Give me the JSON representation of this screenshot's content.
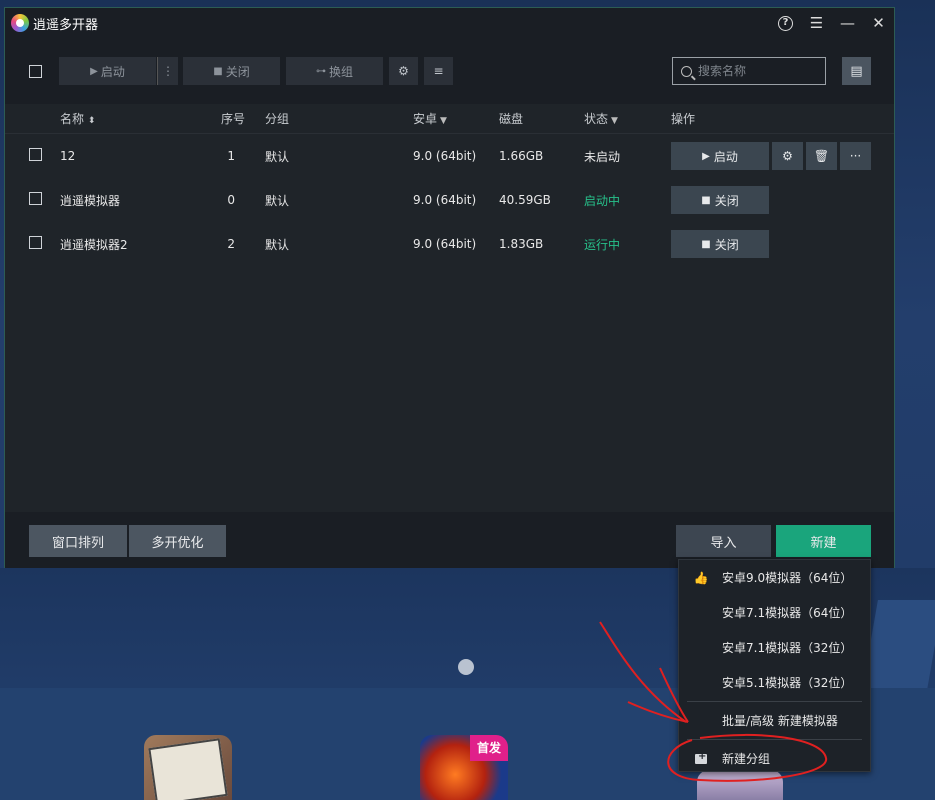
{
  "window": {
    "title": "逍遥多开器",
    "controls": {
      "help": "?",
      "menu": "☰",
      "minimize": "—",
      "close": "✕"
    }
  },
  "toolbar": {
    "start_label": "启动",
    "more_label": "⋮",
    "close_label": "关闭",
    "group_label": "换组",
    "settings_icon": "⚙",
    "list_icon": "≡",
    "search_placeholder": "搜索名称",
    "view_icon": "▤"
  },
  "table": {
    "headers": {
      "name": "名称",
      "index": "序号",
      "group": "分组",
      "android": "安卓",
      "disk": "磁盘",
      "status": "状态",
      "ops": "操作"
    },
    "rows": [
      {
        "name": "12",
        "index": "1",
        "group": "默认",
        "android": "9.0 (64bit)",
        "disk": "1.66GB",
        "status": "未启动",
        "status_state": "stopped",
        "action": "启动"
      },
      {
        "name": "逍遥模拟器",
        "index": "0",
        "group": "默认",
        "android": "9.0 (64bit)",
        "disk": "40.59GB",
        "status": "启动中",
        "status_state": "on",
        "action": "关闭"
      },
      {
        "name": "逍遥模拟器2",
        "index": "2",
        "group": "默认",
        "android": "9.0 (64bit)",
        "disk": "1.83GB",
        "status": "运行中",
        "status_state": "on",
        "action": "关闭"
      }
    ],
    "status_color_on": "#27c08a"
  },
  "footer": {
    "arrange_label": "窗口排列",
    "optimize_label": "多开优化",
    "import_label": "导入",
    "new_label": "新建",
    "new_color": "#1aa57c"
  },
  "dropdown": {
    "items": [
      {
        "label": "安卓9.0模拟器（64位）",
        "icon": "thumbs-up-icon"
      },
      {
        "label": "安卓7.1模拟器（64位）"
      },
      {
        "label": "安卓7.1模拟器（32位）"
      },
      {
        "label": "安卓5.1模拟器（32位）"
      },
      {
        "label": "批量/高级 新建模拟器"
      },
      {
        "label": "新建分组",
        "icon": "folder-add-icon"
      }
    ]
  },
  "desktop": {
    "app_badge": "首发"
  }
}
